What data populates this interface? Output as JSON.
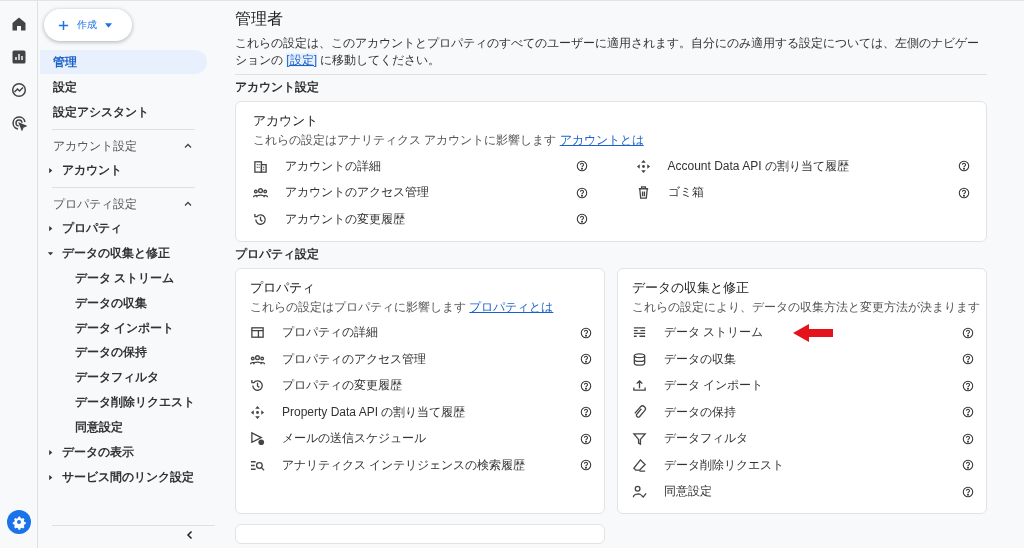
{
  "create_button": {
    "label": "作成"
  },
  "nav": [
    {
      "label": "管理",
      "selected": true
    },
    {
      "label": "設定",
      "selected": false
    },
    {
      "label": "設定アシスタント",
      "selected": false
    }
  ],
  "sections": [
    {
      "title": "アカウント設定",
      "expanded": true,
      "items": [
        {
          "label": "アカウント",
          "expanded": false
        }
      ]
    },
    {
      "title": "プロパティ設定",
      "expanded": true,
      "items": [
        {
          "label": "プロパティ",
          "expanded": false
        },
        {
          "label": "データの収集と修正",
          "expanded": true,
          "children": [
            {
              "label": "データ ストリーム"
            },
            {
              "label": "データの収集"
            },
            {
              "label": "データ インポート"
            },
            {
              "label": "データの保持"
            },
            {
              "label": "データフィルタ"
            },
            {
              "label": "データ削除リクエスト"
            },
            {
              "label": "同意設定"
            }
          ]
        },
        {
          "label": "データの表示",
          "expanded": false
        },
        {
          "label": "サービス間のリンク設定",
          "expanded": false
        }
      ]
    }
  ],
  "page": {
    "title": "管理者",
    "description_before": "これらの設定は、このアカウントとプロパティのすべてのユーザーに適用されます。自分にのみ適用する設定については、左側のナビゲーションの ",
    "description_link": "[設定]",
    "description_after": " に移動してください。"
  },
  "account_heading": "アカウント設定",
  "account_card": {
    "title": "アカウント",
    "description": "これらの設定はアナリティクス アカウントに影響します",
    "link": "アカウントとは",
    "items": [
      {
        "label": "アカウントの詳細"
      },
      {
        "label": "Account Data API の割り当て履歴"
      },
      {
        "label": "アカウントのアクセス管理"
      },
      {
        "label": "ゴミ箱"
      },
      {
        "label": "アカウントの変更履歴"
      }
    ]
  },
  "property_heading": "プロパティ設定",
  "property_card": {
    "title": "プロパティ",
    "description": "これらの設定はプロパティに影響します",
    "link": "プロパティとは",
    "items": [
      {
        "label": "プロパティの詳細"
      },
      {
        "label": "プロパティのアクセス管理"
      },
      {
        "label": "プロパティの変更履歴"
      },
      {
        "label": "Property Data API の割り当て履歴"
      },
      {
        "label": "メールの送信スケジュール"
      },
      {
        "label": "アナリティクス インテリジェンスの検索履歴"
      }
    ]
  },
  "data_card": {
    "title": "データの収集と修正",
    "description": "これらの設定により、データの収集方法と変更方法が決まります",
    "items": [
      {
        "label": "データ ストリーム",
        "highlighted": true
      },
      {
        "label": "データの収集",
        "highlighted": false
      },
      {
        "label": "データ インポート",
        "highlighted": false
      },
      {
        "label": "データの保持",
        "highlighted": false
      },
      {
        "label": "データフィルタ",
        "highlighted": false
      },
      {
        "label": "データ削除リクエスト",
        "highlighted": false
      },
      {
        "label": "同意設定",
        "highlighted": false
      }
    ]
  }
}
